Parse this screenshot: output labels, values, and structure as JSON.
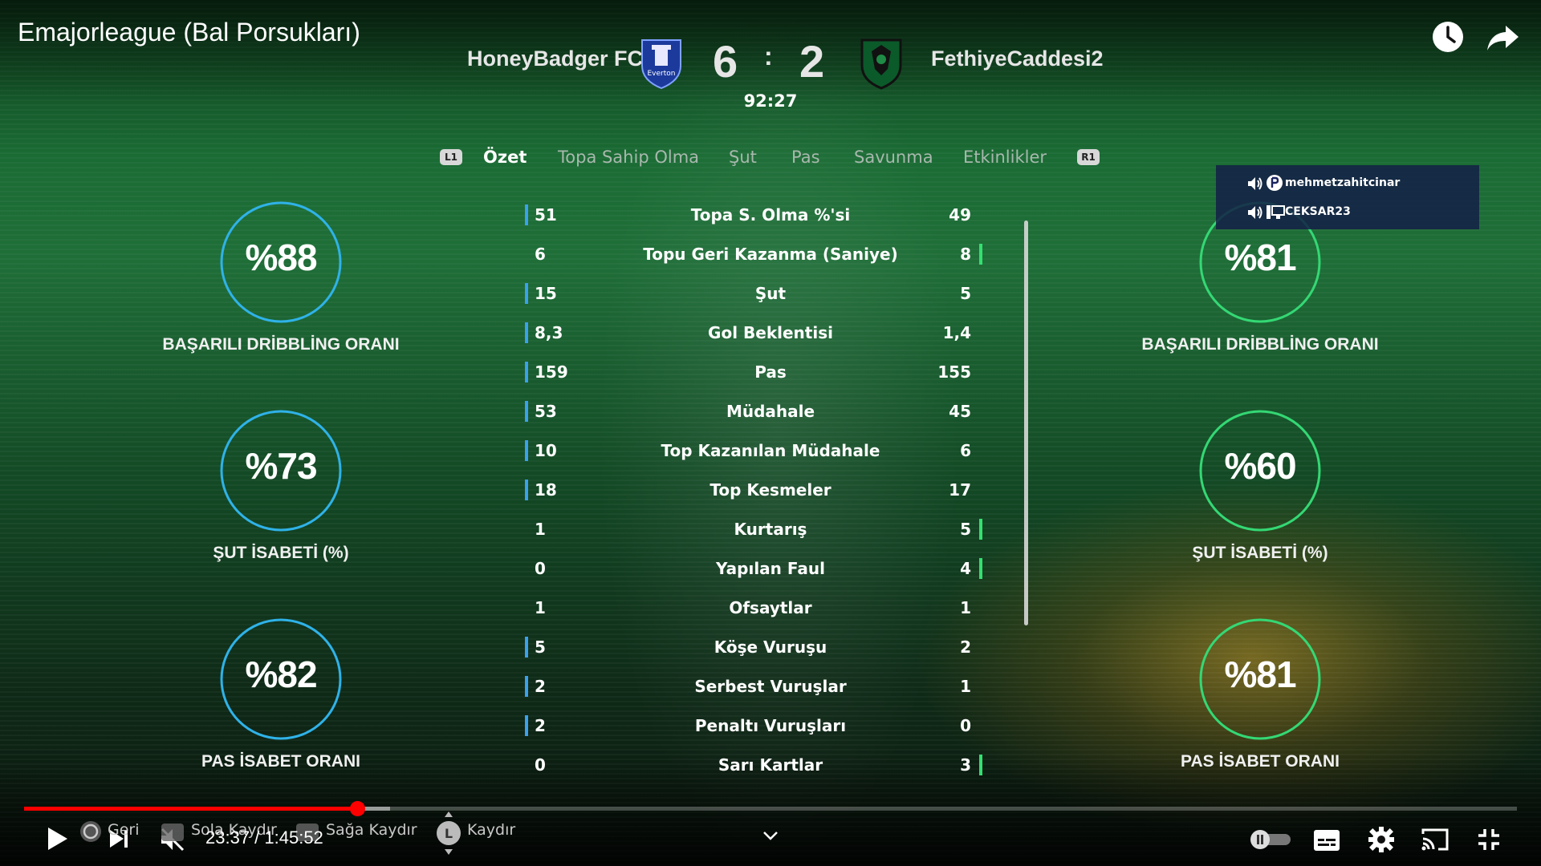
{
  "video": {
    "title": "Emajorleague (Bal Porsukları)",
    "time_display": "23:37 / 1:45:52",
    "progress_fraction": 0.223,
    "buffer_fraction": 0.245
  },
  "match": {
    "home_team": "HoneyBadger FC",
    "away_team": "FethiyeCaddesi2",
    "home_score": "6",
    "separator": ":",
    "away_score": "2",
    "clock": "92:27",
    "home_crest_text": "Everton"
  },
  "tabs": {
    "left_bumper": "L1",
    "right_bumper": "R1",
    "items": [
      "Özet",
      "Topa Sahip Olma",
      "Şut",
      "Pas",
      "Savunma",
      "Etkinlikler"
    ],
    "active_index": 0
  },
  "stats": [
    {
      "label": "Topa S. Olma %'si",
      "home": "51",
      "away": "49",
      "lead": "home"
    },
    {
      "label": "Topu Geri Kazanma (Saniye)",
      "home": "6",
      "away": "8",
      "lead": "away"
    },
    {
      "label": "Şut",
      "home": "15",
      "away": "5",
      "lead": "home"
    },
    {
      "label": "Gol Beklentisi",
      "home": "8,3",
      "away": "1,4",
      "lead": "home"
    },
    {
      "label": "Pas",
      "home": "159",
      "away": "155",
      "lead": "home"
    },
    {
      "label": "Müdahale",
      "home": "53",
      "away": "45",
      "lead": "home"
    },
    {
      "label": "Top Kazanılan Müdahale",
      "home": "10",
      "away": "6",
      "lead": "home"
    },
    {
      "label": "Top Kesmeler",
      "home": "18",
      "away": "17",
      "lead": "home"
    },
    {
      "label": "Kurtarış",
      "home": "1",
      "away": "5",
      "lead": "away"
    },
    {
      "label": "Yapılan Faul",
      "home": "0",
      "away": "4",
      "lead": "away"
    },
    {
      "label": "Ofsaytlar",
      "home": "1",
      "away": "1",
      "lead": "none"
    },
    {
      "label": "Köşe Vuruşu",
      "home": "5",
      "away": "2",
      "lead": "home"
    },
    {
      "label": "Serbest Vuruşlar",
      "home": "2",
      "away": "1",
      "lead": "home"
    },
    {
      "label": "Penaltı Vuruşları",
      "home": "2",
      "away": "0",
      "lead": "home"
    },
    {
      "label": "Sarı Kartlar",
      "home": "0",
      "away": "3",
      "lead": "away"
    }
  ],
  "rings": {
    "home": [
      {
        "value": "%88",
        "label": "BAŞARILI DRİBBLİNG ORANI"
      },
      {
        "value": "%73",
        "label": "ŞUT İSABETİ (%)"
      },
      {
        "value": "%82",
        "label": "PAS İSABET ORANI"
      }
    ],
    "away": [
      {
        "value": "%81",
        "label": "BAŞARILI DRİBBLİNG ORANI"
      },
      {
        "value": "%60",
        "label": "ŞUT İSABETİ (%)"
      },
      {
        "value": "%81",
        "label": "PAS İSABET ORANI"
      }
    ]
  },
  "voice_chat": {
    "users": [
      {
        "name": "mehmetzahitcinar",
        "platform": "playstation-icon"
      },
      {
        "name": "CEKSAR23",
        "platform": "pc-icon"
      }
    ]
  },
  "controller_hints": {
    "back": "Geri",
    "scroll_left": "Sola Kaydır",
    "scroll_right": "Sağa Kaydır",
    "scroll": "Kaydır"
  },
  "colors": {
    "home_accent": "#3aa0f0",
    "away_accent": "#33e070",
    "progress_red": "#ff0000"
  }
}
